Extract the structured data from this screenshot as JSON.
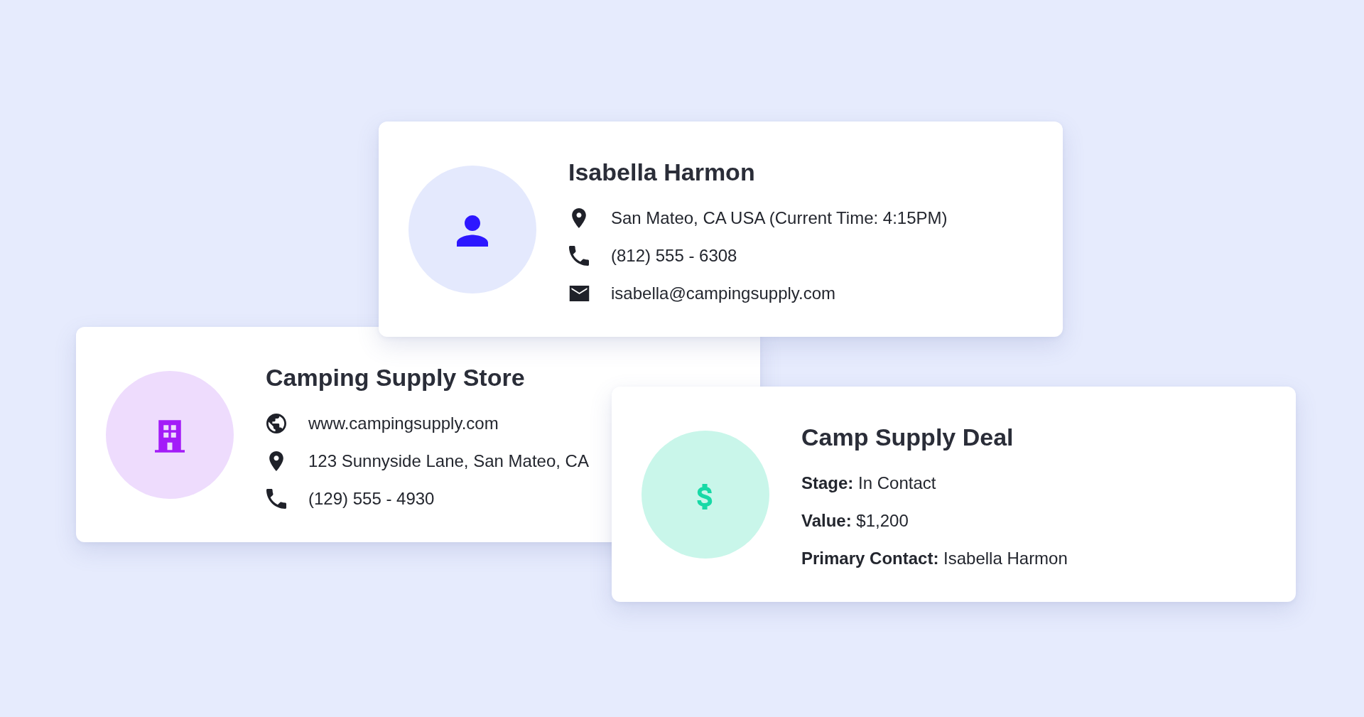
{
  "cards": [
    {
      "kind": "contact",
      "title": "Isabella Harmon",
      "rows": [
        {
          "kind": "location",
          "text": "San Mateo, CA USA (Current Time: 4:15PM)"
        },
        {
          "kind": "phone",
          "text": "(812) 555 - 6308"
        },
        {
          "kind": "email",
          "text": "isabella@campingsupply.com"
        }
      ]
    },
    {
      "kind": "company",
      "title": "Camping Supply Store",
      "rows": [
        {
          "kind": "website",
          "text": "www.campingsupply.com"
        },
        {
          "kind": "location",
          "text": "123 Sunnyside Lane, San Mateo, CA"
        },
        {
          "kind": "phone",
          "text": "(129) 555 - 4930"
        }
      ]
    },
    {
      "kind": "deal",
      "title": "Camp Supply Deal",
      "rows": [
        {
          "kind": "field",
          "text": "**Stage:** In Contact"
        },
        {
          "kind": "field",
          "text": "**Value:** $1,200"
        },
        {
          "kind": "field",
          "text": "**Primary Contact:** Isabella Harmon"
        }
      ]
    }
  ]
}
